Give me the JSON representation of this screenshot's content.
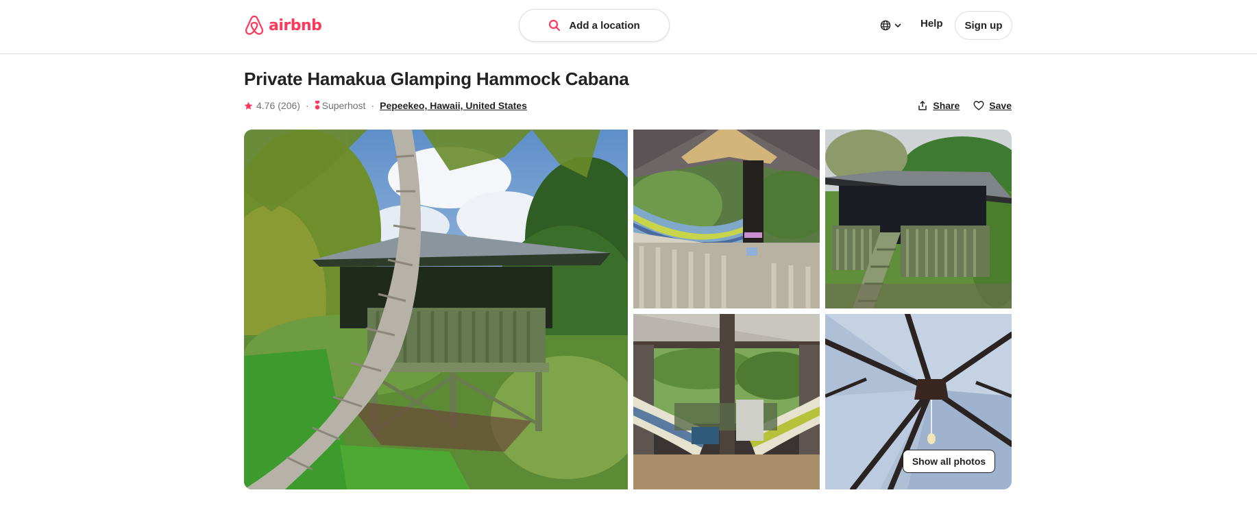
{
  "header": {
    "brand": "airbnb",
    "search_label": "Add a location",
    "help_label": "Help",
    "signup_label": "Sign up"
  },
  "icons": {
    "logo": "airbnb-logo-icon",
    "search": "search-icon",
    "language": "globe-icon",
    "chevron": "chevron-down-icon",
    "rating": "star-icon",
    "superhost": "superhost-medal-icon",
    "share": "share-icon",
    "save": "heart-icon"
  },
  "listing": {
    "title": "Private Hamakua Glamping Hammock Cabana",
    "rating": "4.76",
    "reviews": "(206)",
    "separator": "·",
    "superhost_label": "Superhost",
    "location": "Pepeekeo, Hawaii, United States",
    "share_label": "Share",
    "save_label": "Save"
  },
  "gallery": {
    "show_all_label": "Show all photos"
  },
  "colors": {
    "brand": "#ff385c",
    "text": "#222222",
    "muted": "#717171",
    "border": "#dddddd"
  }
}
